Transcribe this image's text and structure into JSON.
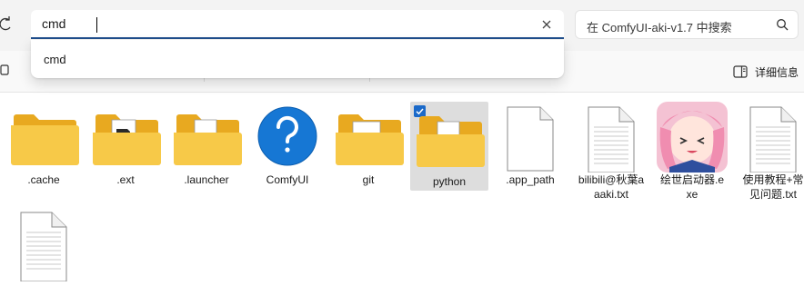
{
  "address_bar": {
    "value": "cmd"
  },
  "search": {
    "placeholder": "在 ComfyUI-aki-v1.7 中搜索"
  },
  "suggestions": [
    {
      "label": "cmd"
    }
  ],
  "command_bar": {
    "details_label": "详细信息"
  },
  "files": [
    {
      "name": ".cache",
      "type": "folder",
      "icon": "folder-icon"
    },
    {
      "name": ".ext",
      "type": "folder",
      "icon": "folder-file-icon"
    },
    {
      "name": ".launcher",
      "type": "folder",
      "icon": "folder-file-icon"
    },
    {
      "name": "ComfyUI",
      "type": "shortcut",
      "icon": "help-icon"
    },
    {
      "name": "git",
      "type": "folder",
      "icon": "folder-file-icon"
    },
    {
      "name": "python",
      "type": "folder",
      "icon": "folder-file-icon",
      "selected": true
    },
    {
      "name": ".app_path",
      "type": "file",
      "icon": "blank-file-icon"
    },
    {
      "name": "bilibili@秋葉aaaki.txt",
      "type": "text",
      "icon": "text-file-icon"
    },
    {
      "name": "绘世启动器.exe",
      "type": "exe",
      "icon": "anime-app-icon"
    },
    {
      "name": "使用教程+常见问题.txt",
      "type": "text",
      "icon": "text-file-icon"
    },
    {
      "name": "",
      "type": "text",
      "icon": "text-file-icon"
    }
  ],
  "colors": {
    "accent": "#1f4e8c",
    "folder": "#f7c948",
    "selected_bg": "#dddddd"
  }
}
